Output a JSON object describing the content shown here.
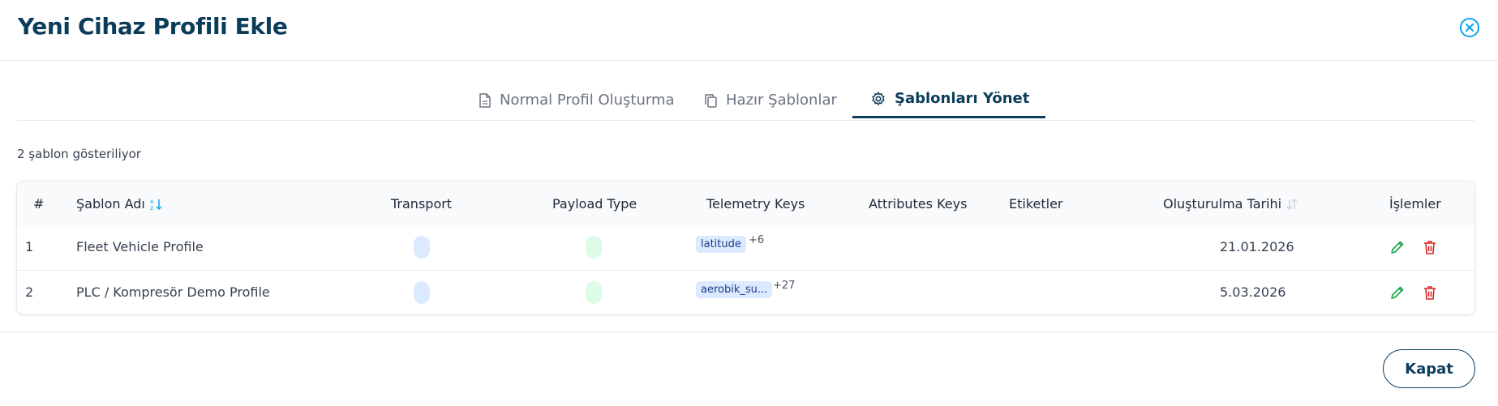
{
  "dialog": {
    "title": "Yeni Cihaz Profili Ekle",
    "close_icon": "close-circle-icon"
  },
  "tabs": [
    {
      "label": "Normal Profil Oluşturma",
      "icon": "document-icon",
      "active": false
    },
    {
      "label": "Hazır Şablonlar",
      "icon": "copy-icon",
      "active": false
    },
    {
      "label": "Şablonları Yönet",
      "icon": "gear-icon",
      "active": true
    }
  ],
  "summary": {
    "count_text": "2 şablon gösteriliyor"
  },
  "table": {
    "columns": {
      "index": "#",
      "name": "Şablon Adı",
      "transport": "Transport",
      "payload": "Payload Type",
      "telemetry": "Telemetry Keys",
      "attributes": "Attributes Keys",
      "tags": "Etiketler",
      "created": "Oluşturulma Tarihi",
      "actions": "İşlemler"
    },
    "rows": [
      {
        "index": "1",
        "name": "Fleet Vehicle Profile",
        "telemetry_chip": "latitude",
        "telemetry_more": "+6",
        "created": "21.01.2026"
      },
      {
        "index": "2",
        "name": "PLC / Kompresör Demo Profile",
        "telemetry_chip": "aerobik_su...",
        "telemetry_more": "+27",
        "created": "5.03.2026"
      }
    ]
  },
  "footer": {
    "close_label": "Kapat"
  },
  "colors": {
    "primary": "#0b3d5b",
    "accent": "#0ea5e9",
    "edit": "#16a34a",
    "delete": "#dc2626",
    "chip_bg": "#dbeafe",
    "pill_green": "#dcfce7"
  }
}
